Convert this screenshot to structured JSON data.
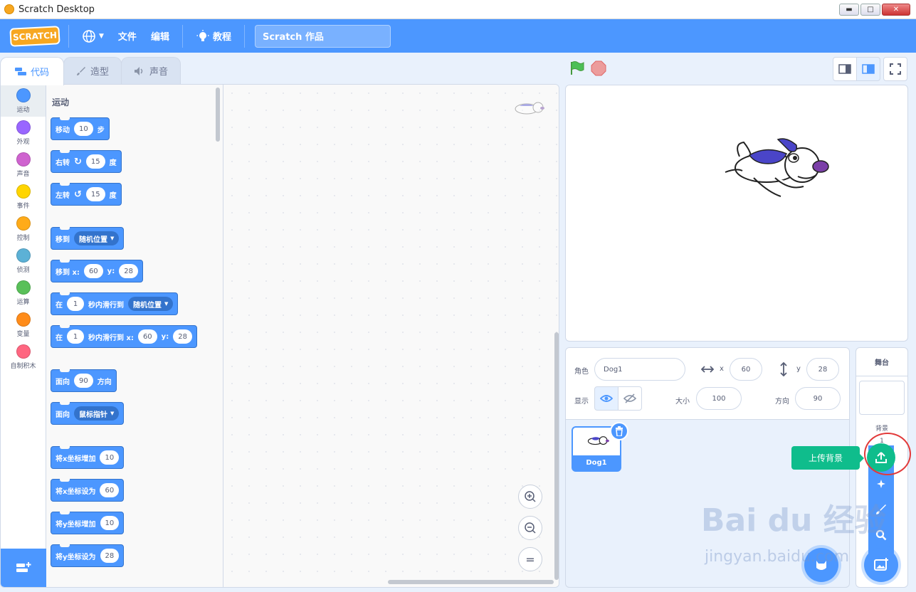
{
  "window": {
    "title": "Scratch Desktop"
  },
  "menubar": {
    "logo": "SCRATCH",
    "file": "文件",
    "edit": "编辑",
    "tutorials": "教程",
    "project_title": "Scratch 作品"
  },
  "tabs": [
    {
      "label": "代码"
    },
    {
      "label": "造型"
    },
    {
      "label": "声音"
    }
  ],
  "categories": [
    {
      "label": "运动",
      "color": "#4c97ff"
    },
    {
      "label": "外观",
      "color": "#9966ff"
    },
    {
      "label": "声音",
      "color": "#cf63cf"
    },
    {
      "label": "事件",
      "color": "#ffd500"
    },
    {
      "label": "控制",
      "color": "#ffab19"
    },
    {
      "label": "侦测",
      "color": "#5cb1d6"
    },
    {
      "label": "运算",
      "color": "#59c059"
    },
    {
      "label": "变量",
      "color": "#ff8c1a"
    },
    {
      "label": "自制积木",
      "color": "#ff6680"
    }
  ],
  "palette": {
    "heading": "运动",
    "blocks": {
      "move": {
        "t1": "移动",
        "v1": "10",
        "t2": "步"
      },
      "turn_right": {
        "t1": "右转",
        "v1": "15",
        "t2": "度"
      },
      "turn_left": {
        "t1": "左转",
        "v1": "15",
        "t2": "度"
      },
      "goto": {
        "t1": "移到",
        "d1": "随机位置"
      },
      "goto_xy": {
        "t1": "移到 x:",
        "v1": "60",
        "t2": "y:",
        "v2": "28"
      },
      "glide": {
        "t1": "在",
        "v1": "1",
        "t2": "秒内滑行到",
        "d1": "随机位置"
      },
      "glide_xy": {
        "t1": "在",
        "v1": "1",
        "t2": "秒内滑行到 x:",
        "v2": "60",
        "t3": "y:",
        "v3": "28"
      },
      "point": {
        "t1": "面向",
        "v1": "90",
        "t2": "方向"
      },
      "point_towards": {
        "t1": "面向",
        "d1": "鼠标指针"
      },
      "change_x": {
        "t1": "将x坐标增加",
        "v1": "10"
      },
      "set_x": {
        "t1": "将x坐标设为",
        "v1": "60"
      },
      "change_y": {
        "t1": "将y坐标增加",
        "v1": "10"
      },
      "set_y": {
        "t1": "将y坐标设为",
        "v1": "28"
      }
    }
  },
  "sprite_info": {
    "sprite_label": "角色",
    "sprite_name": "Dog1",
    "x_label": "x",
    "x": "60",
    "y_label": "y",
    "y": "28",
    "show_label": "显示",
    "size_label": "大小",
    "size": "100",
    "direction_label": "方向",
    "direction": "90"
  },
  "sprites": [
    {
      "name": "Dog1"
    }
  ],
  "stage_pane": {
    "header": "舞台",
    "backdrops_label": "背景",
    "backdrops_count": "1",
    "upload_tooltip": "上传背景"
  },
  "watermark": {
    "brand": "Bai du 经验",
    "url": "jingyan.baidu.com"
  },
  "colors": {
    "accent": "#4c97ff",
    "tooltip": "#0fbd8c",
    "highlight_circle": "#e23a3a"
  }
}
